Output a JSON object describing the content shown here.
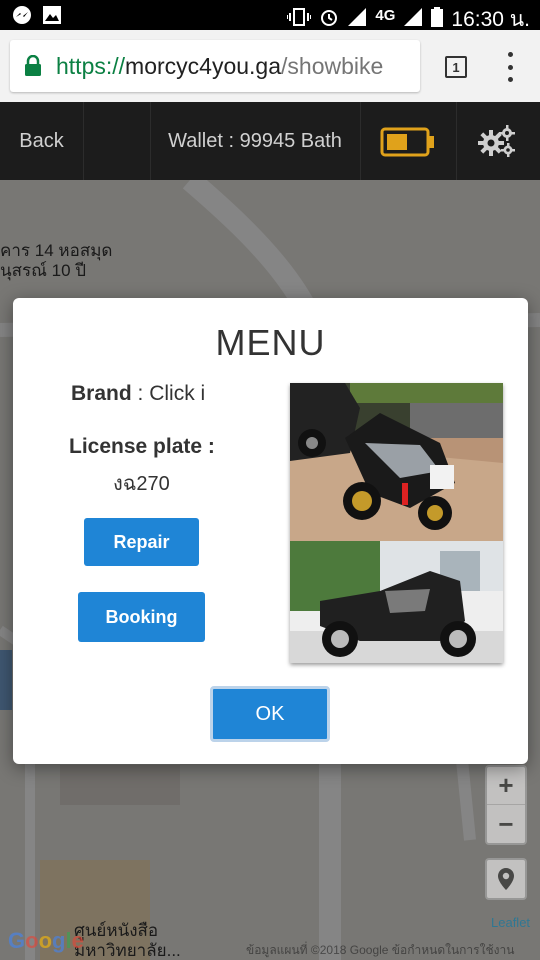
{
  "status_bar": {
    "network": "4G",
    "time": "16:30 น."
  },
  "browser": {
    "url_scheme": "https://",
    "url_host": "morcyc4you.ga",
    "url_path": "/showbike",
    "tab_count": "1"
  },
  "header": {
    "back_label": "Back",
    "wallet_label": "Wallet : 99945 Bath"
  },
  "map": {
    "label_line1": "คาร 14 หอสมุด",
    "label_line2": "นุสรณ์ 10 ปี",
    "label_bottom1": "ศูนย์หนังสือ",
    "label_bottom2": "มหาวิทยาลัย...",
    "zoom_in": "+",
    "zoom_out": "−",
    "leaflet": "Leaflet",
    "google_attr": "ข้อมูลแผนที่ ©2018 Google    ข้อกำหนดในการใช้งาน"
  },
  "modal": {
    "title": "MENU",
    "brand_label": "Brand",
    "brand_value": " : Click i",
    "plate_label": "License plate :",
    "plate_value": "งฉ270",
    "repair_label": "Repair",
    "booking_label": "Booking",
    "ok_label": "OK"
  },
  "colors": {
    "accent": "#1f85d6",
    "header_bg": "#1c1c1c",
    "battery": "#e0a21b"
  }
}
